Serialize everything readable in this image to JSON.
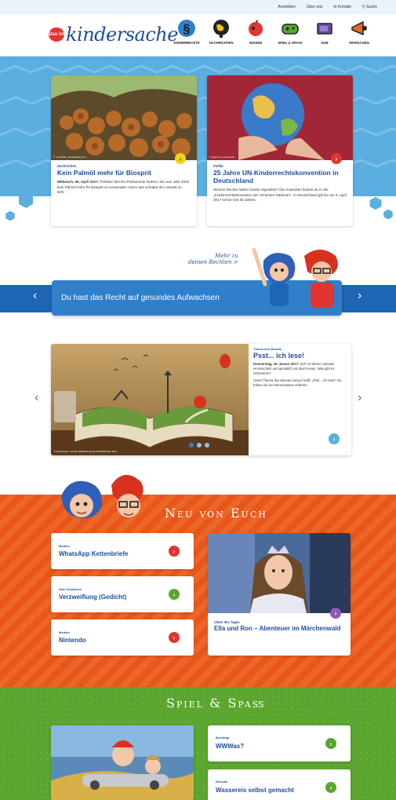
{
  "topbar": {
    "links": [
      "Anmelden",
      "Über uns",
      "Kontakt",
      "Suche"
    ]
  },
  "logo": {
    "badge": "Das ist",
    "name": "kindersache"
  },
  "nav": [
    {
      "label": "KINDERRECHTE",
      "icon": "paragraph-icon"
    },
    {
      "label": "NACHRICHTEN",
      "icon": "globe-icon"
    },
    {
      "label": "WISSEN",
      "icon": "brain-icon"
    },
    {
      "label": "SPIEL & SPASS",
      "icon": "gamepad-icon"
    },
    {
      "label": "ZUM",
      "icon": "tv-icon"
    },
    {
      "label": "MITMACHEN",
      "icon": "megaphone-icon"
    }
  ],
  "news": [
    {
      "category": "Nachrichten",
      "title": "Kein Palmöl mehr für Biosprit",
      "date": "Mittwoch, 05. April 2017:",
      "text": "Politiker des EU-Parlaments fordern, bis zum Jahr 2020 kein Palmöl mehr für Biosprit zu verwenden. Denn das schadet der Umwelt zu sehr.",
      "credit": "© romantiker_foto/pixabay.com"
    },
    {
      "category": "Politik",
      "title": "25 Jahre UN-Kinderrechtskonvention in Deutschland",
      "text": "Welche Rechte haben Kinder eigentlich? Die Antworten findest du in der „Kinderrechtskonvention der Vereinten Nationen\". In Deutschland gilt sie am 5. April 2017 schon seit 25 Jahren.",
      "credit": "© pixelio.de_maxpostac"
    }
  ],
  "rights": {
    "note_line1": "Mehr zu",
    "note_line2": "deinen Rechten >",
    "text": "Du hast das Recht auf gesundes Aufwachsen"
  },
  "feature": {
    "category": "Thema des Monats",
    "title": "Psst... ich lese!",
    "date": "Donnerstag, 19. Januar 2017:",
    "text1": "Sich im Winter zuhause einmuscheln und gemütlich ein Buch lesen. Was gibt es Schöneres?",
    "text2": "Unser Thema des Monats Januar heißt: „Psst... ich lese!\" Da haben wir viel Interessantes erfahren.",
    "credit": "© Fotowissen / Fotolia, Bildbearbeitung: DKHW/Dörfler 2017"
  },
  "neu": {
    "title": "Neu von Euch",
    "items": [
      {
        "category": "Medien",
        "title": "WhatsApp Kettenbriefe",
        "color": "#e3342f"
      },
      {
        "category": "Dein Gedanken",
        "title": "Verzweiflung (Gedicht)",
        "color": "#5aa62f"
      },
      {
        "category": "Medien",
        "title": "Nintendo",
        "color": "#e3342f"
      }
    ],
    "video": {
      "category": "Video des Tages",
      "title": "Ella und Ron – Abenteuer im Märchenwald"
    }
  },
  "spiel": {
    "title": "Spiel & Spaß",
    "items": [
      {
        "category": "Buchtipp",
        "title": "WWWas?"
      },
      {
        "category": "Rezepte",
        "title": "Wassereis selbst gemacht"
      }
    ]
  }
}
